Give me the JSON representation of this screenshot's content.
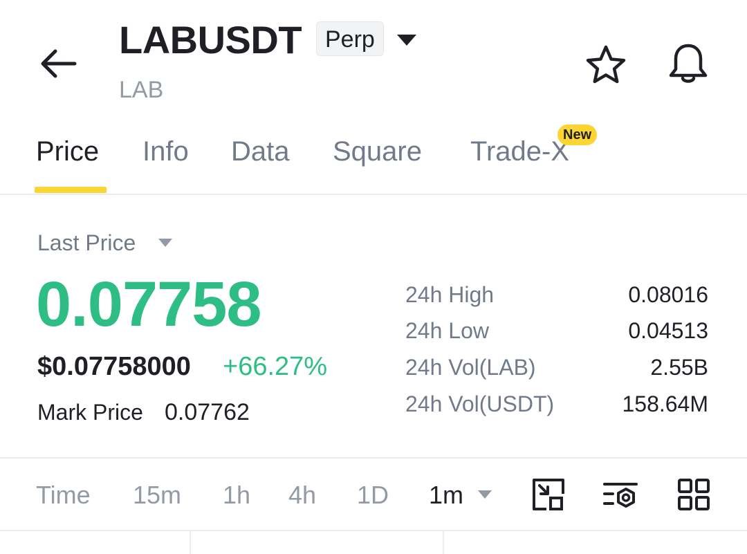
{
  "header": {
    "back_icon": "arrow-left-icon",
    "title": "LABUSDT",
    "contract_badge": "Perp",
    "subtitle": "LAB",
    "favorite_icon": "star-icon",
    "alert_icon": "bell-icon"
  },
  "tabs": [
    {
      "label": "Price",
      "active": true
    },
    {
      "label": "Info",
      "active": false
    },
    {
      "label": "Data",
      "active": false
    },
    {
      "label": "Square",
      "active": false
    },
    {
      "label": "Trade-X",
      "active": false,
      "badge": "New"
    }
  ],
  "price": {
    "selector_label": "Last Price",
    "last_price": "0.07758",
    "usd_price": "$0.07758000",
    "change_percent": "+66.27%",
    "mark_label": "Mark Price",
    "mark_value": "0.07762"
  },
  "stats": [
    {
      "label": "24h High",
      "value": "0.08016"
    },
    {
      "label": "24h Low",
      "value": "0.04513"
    },
    {
      "label": "24h Vol(LAB)",
      "value": "2.55B"
    },
    {
      "label": "24h Vol(USDT)",
      "value": "158.64M"
    }
  ],
  "intervals": {
    "items": [
      "Time",
      "15m",
      "1h",
      "4h",
      "1D"
    ],
    "selected": "1m"
  },
  "chart_tools": [
    "fullscreen-icon",
    "indicator-settings-icon",
    "grid-layout-icon"
  ],
  "colors": {
    "accent": "#fcd535",
    "up": "#2ebd85",
    "text_primary": "#1e2026",
    "text_secondary": "#707a8a"
  }
}
